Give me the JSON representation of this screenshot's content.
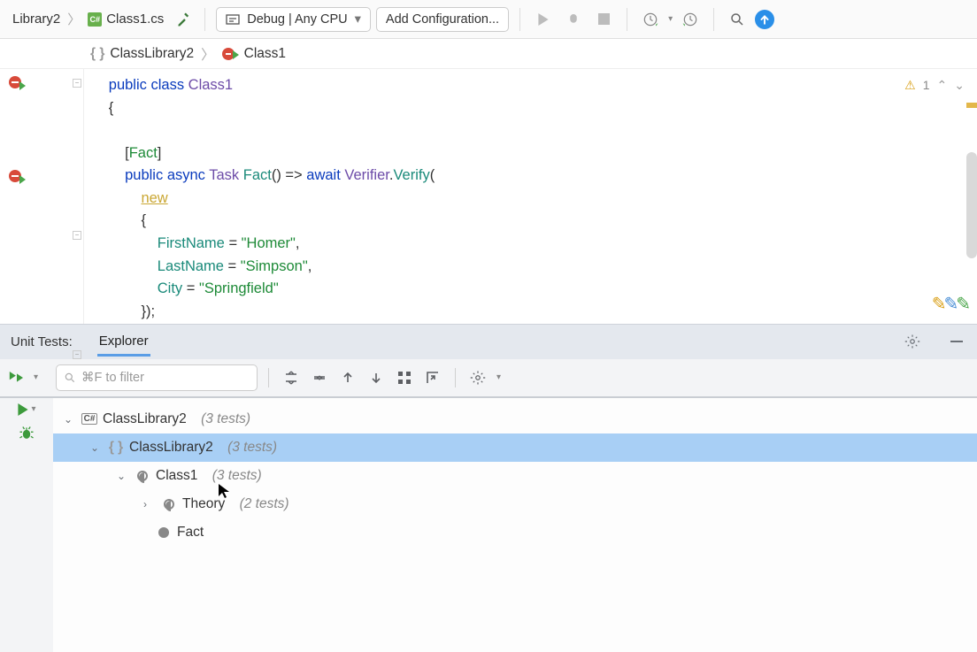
{
  "toolbar": {
    "crumb1": "Library2",
    "crumb2": "Class1.cs",
    "configLabel": "Debug | Any CPU",
    "addConfigLabel": "Add Configuration..."
  },
  "breadcrumb": {
    "item1": "ClassLibrary2",
    "item2": "Class1"
  },
  "code": {
    "line1_a": "public",
    "line1_b": "class",
    "line1_c": "Class1",
    "line2": "{",
    "line3_a": "[",
    "line3_b": "Fact",
    "line3_c": "]",
    "line4_a": "public",
    "line4_b": "async",
    "line4_c": "Task",
    "line4_d": "Fact",
    "line4_e": "() => ",
    "line4_f": "await",
    "line4_g": "Verifier",
    "line4_h": ".",
    "line4_i": "Verify",
    "line4_j": "(",
    "line5": "new",
    "line6": "{",
    "line7_a": "FirstName",
    "line7_b": " = ",
    "line7_c": "\"Homer\"",
    "line7_d": ",",
    "line8_a": "LastName",
    "line8_b": " = ",
    "line8_c": "\"Simpson\"",
    "line8_d": ",",
    "line9_a": "City",
    "line9_b": " = ",
    "line9_c": "\"Springfield\"",
    "line10": "});"
  },
  "codeBadge": {
    "warnCount": "1"
  },
  "utHeader": {
    "label": "Unit Tests:",
    "tab": "Explorer"
  },
  "utSearch": {
    "placeholder": "⌘F to filter"
  },
  "tree": {
    "n1": "ClassLibrary2",
    "c1": "(3 tests)",
    "n2": "ClassLibrary2",
    "c2": "(3 tests)",
    "n3": "Class1",
    "c3": "(3 tests)",
    "n4": "Theory",
    "c4": "(2 tests)",
    "n5": "Fact"
  }
}
